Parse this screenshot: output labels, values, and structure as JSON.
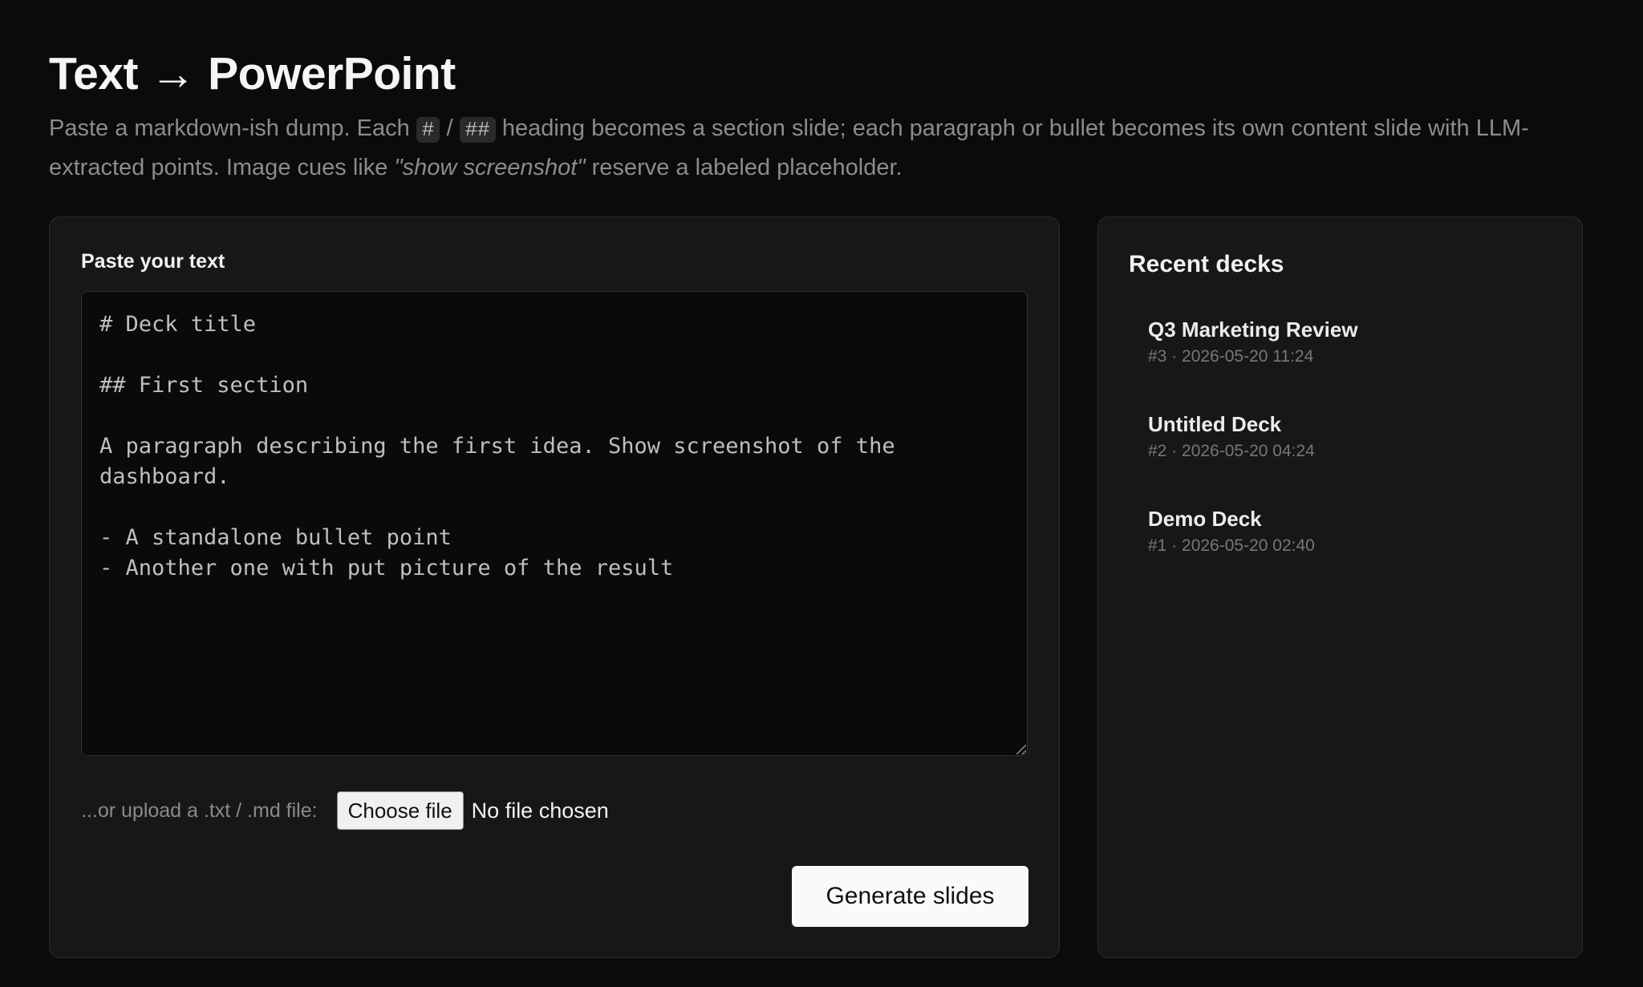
{
  "header": {
    "title": "Text → PowerPoint",
    "subtitle_part1": "Paste a markdown-ish dump. Each ",
    "code_h1": "#",
    "subtitle_sep": " / ",
    "code_h2": "##",
    "subtitle_part2": " heading becomes a section slide; each paragraph or bullet becomes its own content slide with LLM-extracted points. Image cues like ",
    "subtitle_em": "\"show screenshot\"",
    "subtitle_part3": " reserve a labeled placeholder."
  },
  "editor": {
    "label": "Paste your text",
    "value": "# Deck title\n\n## First section\n\nA paragraph describing the first idea. Show screenshot of the\ndashboard.\n\n- A standalone bullet point\n- Another one with put picture of the result"
  },
  "upload": {
    "label": "...or upload a .txt / .md file:",
    "button_label": "Choose file",
    "status": "No file chosen"
  },
  "actions": {
    "generate_label": "Generate slides"
  },
  "recent": {
    "title": "Recent decks",
    "items": [
      {
        "name": "Q3 Marketing Review",
        "meta": "#3 · 2026-05-20 11:24"
      },
      {
        "name": "Untitled Deck",
        "meta": "#2 · 2026-05-20 04:24"
      },
      {
        "name": "Demo Deck",
        "meta": "#1 · 2026-05-20 02:40"
      }
    ]
  }
}
